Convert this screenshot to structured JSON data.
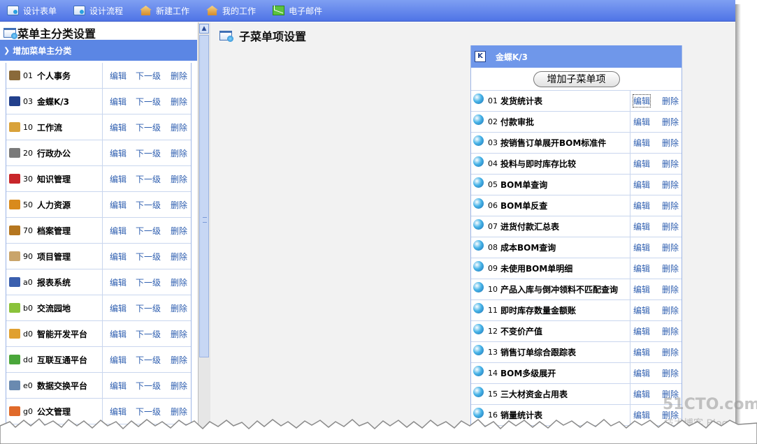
{
  "toolbar": {
    "items": [
      {
        "label": "设计表单",
        "icon": "form-icon"
      },
      {
        "label": "设计流程",
        "icon": "flow-icon"
      },
      {
        "label": "新建工作",
        "icon": "house-icon"
      },
      {
        "label": "我的工作",
        "icon": "house-icon"
      },
      {
        "label": "电子邮件",
        "icon": "mail-icon"
      }
    ]
  },
  "left": {
    "title": "菜单主分类设置",
    "add_label": "增加菜单主分类",
    "items": [
      {
        "code": "01",
        "label": "个人事务",
        "color": "#8a6a3a"
      },
      {
        "code": "03",
        "label": "金蝶K/3",
        "color": "#22408c"
      },
      {
        "code": "10",
        "label": "工作流",
        "color": "#d9a23a"
      },
      {
        "code": "20",
        "label": "行政办公",
        "color": "#7a7a7a"
      },
      {
        "code": "30",
        "label": "知识管理",
        "color": "#c8262a"
      },
      {
        "code": "50",
        "label": "人力资源",
        "color": "#d98a1c"
      },
      {
        "code": "70",
        "label": "档案管理",
        "color": "#b5761f"
      },
      {
        "code": "90",
        "label": "项目管理",
        "color": "#c9a46a"
      },
      {
        "code": "a0",
        "label": "报表系统",
        "color": "#3a5fae"
      },
      {
        "code": "b0",
        "label": "交流园地",
        "color": "#8ac23a"
      },
      {
        "code": "d0",
        "label": "智能开发平台",
        "color": "#e0a030"
      },
      {
        "code": "dd",
        "label": "互联互通平台",
        "color": "#4aa63a"
      },
      {
        "code": "e0",
        "label": "数据交换平台",
        "color": "#6a8ab0"
      },
      {
        "code": "g0",
        "label": "公文管理",
        "color": "#e06a2a"
      }
    ],
    "action_edit": "编辑",
    "action_next": "下一级",
    "action_delete": "删除"
  },
  "right": {
    "title": "子菜单项设置",
    "panel_title": "金蝶K/3",
    "panel_icon_text": "K",
    "add_sub_label": "增加子菜单项",
    "action_edit": "编辑",
    "action_delete": "删除",
    "items": [
      {
        "code": "01",
        "label": "发货统计表"
      },
      {
        "code": "02",
        "label": "付款审批"
      },
      {
        "code": "03",
        "label": "按销售订单展开BOM标准件"
      },
      {
        "code": "04",
        "label": "投料与即时库存比较"
      },
      {
        "code": "05",
        "label": "BOM单查询"
      },
      {
        "code": "06",
        "label": "BOM单反查"
      },
      {
        "code": "07",
        "label": "进货付款汇总表"
      },
      {
        "code": "08",
        "label": "成本BOM查询"
      },
      {
        "code": "09",
        "label": "未使用BOM单明细"
      },
      {
        "code": "10",
        "label": "产品入库与倒冲领料不匹配查询"
      },
      {
        "code": "11",
        "label": "即时库存数量金额账"
      },
      {
        "code": "12",
        "label": "不变价产值"
      },
      {
        "code": "13",
        "label": "销售订单综合跟踪表"
      },
      {
        "code": "14",
        "label": "BOM多级展开"
      },
      {
        "code": "15",
        "label": "三大材资金占用表"
      },
      {
        "code": "16",
        "label": "销量统计表"
      }
    ]
  },
  "watermark": {
    "line1": "51CTO.com",
    "line2": "技术博客  Blog"
  }
}
